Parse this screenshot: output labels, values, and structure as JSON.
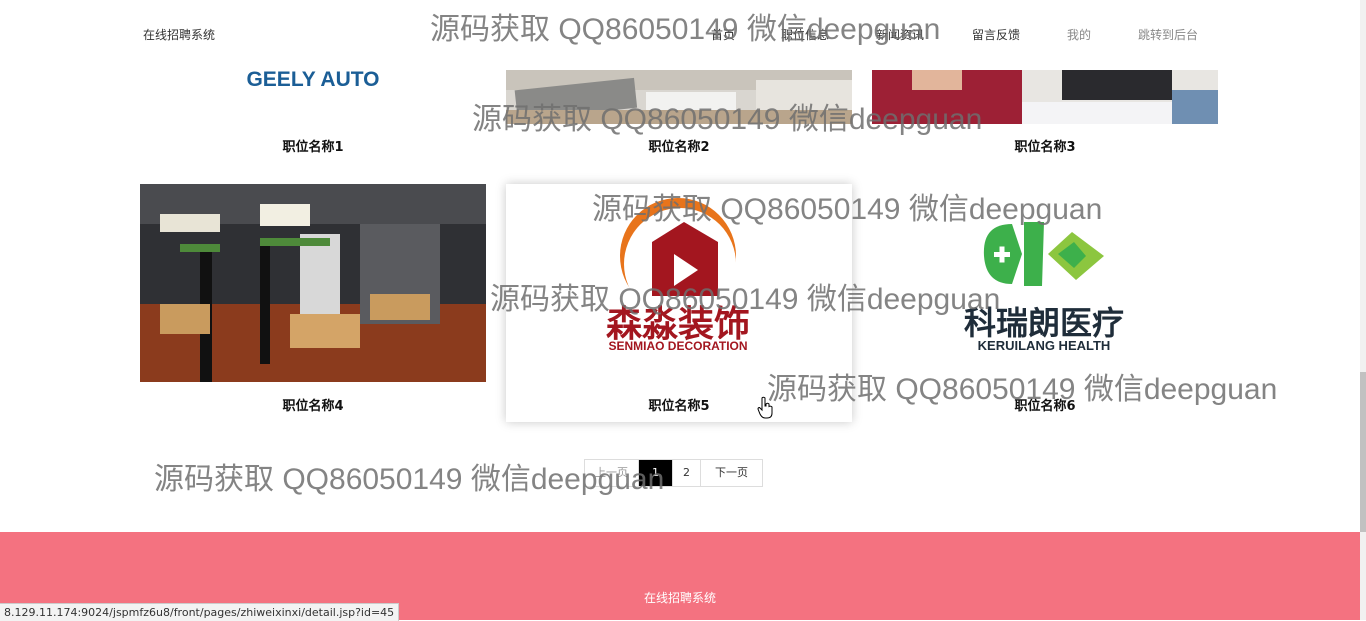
{
  "header": {
    "brand": "在线招聘系统",
    "nav": [
      {
        "label": "首页"
      },
      {
        "label": "职位信息"
      },
      {
        "label": "新闻资讯"
      },
      {
        "label": "留言反馈"
      },
      {
        "label": "我的"
      },
      {
        "label": "跳转到后台"
      }
    ]
  },
  "jobs": [
    {
      "title": "职位名称1",
      "logo_text": "GEELY AUTO"
    },
    {
      "title": "职位名称2"
    },
    {
      "title": "职位名称3"
    },
    {
      "title": "职位名称4"
    },
    {
      "title": "职位名称5",
      "logo_cn": "森淼装饰",
      "logo_en": "SENMIAO DECORATION"
    },
    {
      "title": "职位名称6",
      "logo_cn": "科瑞朗医疗",
      "logo_en": "KERUILANG HEALTH"
    }
  ],
  "pagination": {
    "prev": "上一页",
    "pages": [
      "1",
      "2"
    ],
    "current": "1",
    "next": "下一页"
  },
  "footer": {
    "text": "在线招聘系统"
  },
  "status_url": "8.129.11.174:9024/jspmfz6u8/front/pages/zhiweixinxi/detail.jsp?id=45",
  "watermark": "源码获取 QQ86050149 微信deepguan",
  "colors": {
    "footer_bg": "#f47280",
    "active_page": "#000000",
    "geely_blue": "#1b5e96",
    "senmiao_orange": "#e8741b",
    "senmiao_red": "#a3161f",
    "keruilang_green": "#3db04b"
  }
}
